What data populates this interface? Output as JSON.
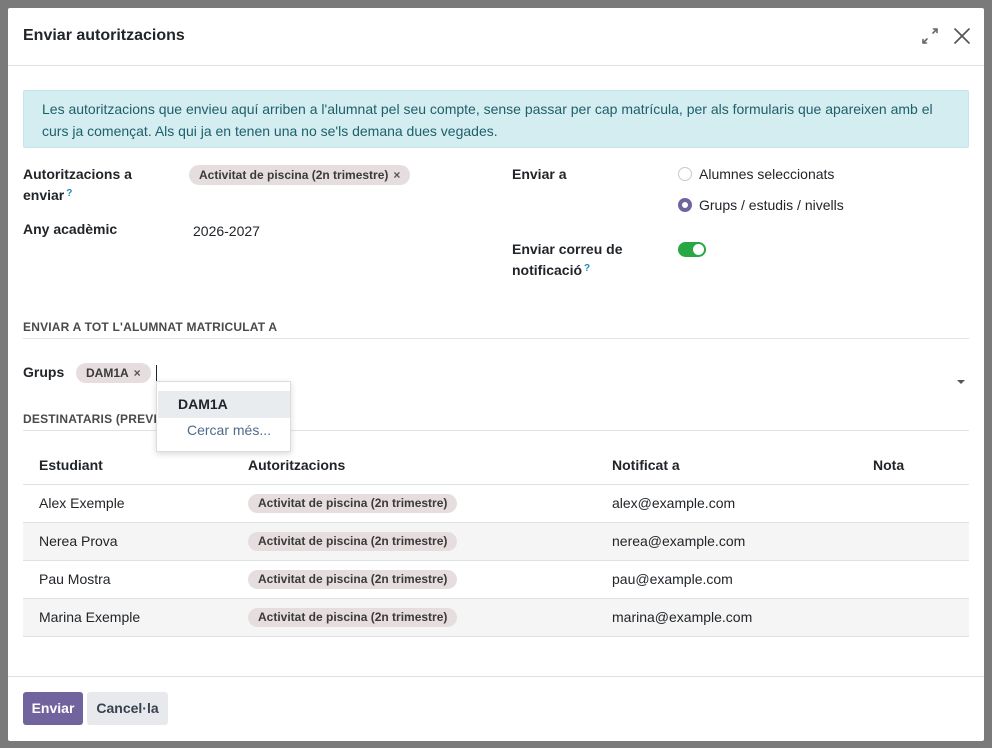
{
  "dialog": {
    "title": "Enviar autoritzacions",
    "expand_icon": "expand-icon",
    "close_icon": "close-icon"
  },
  "alert": {
    "text": "Les autoritzacions que envieu aquí arriben a l'alumnat pel seu compte, sense passar per cap matrícula, per als formularis que apareixen amb el curs ja començat. Als qui ja en tenen una no se'ls demana dues vegades."
  },
  "form": {
    "authorizations_label_1": "Autoritzacions a",
    "authorizations_label_2": "enviar",
    "help_mark": "?",
    "authorizations_tag": "Activitat de piscina (2n trimestre)",
    "tag_remove": "×",
    "year_label": "Any acadèmic",
    "year_value": "2026-2027",
    "send_to_label": "Enviar a",
    "send_to_options": [
      {
        "label": "Alumnes seleccionats",
        "selected": false
      },
      {
        "label": "Grups / estudis / nivells",
        "selected": true
      }
    ],
    "notify_label_1": "Enviar correu de",
    "notify_label_2": "notificació",
    "notify_enabled": true
  },
  "section_all": {
    "title": "ENVIAR A TOT L'ALUMNAT MATRICULAT A",
    "groups_label": "Grups",
    "group_tag": "DAM1A"
  },
  "dropdown": {
    "option_1": "DAM1A",
    "search_more": "Cercar més..."
  },
  "section_recipients": {
    "title": "DESTINATARIS (PREVI"
  },
  "table": {
    "headers": [
      "Estudiant",
      "Autoritzacions",
      "Notificat a",
      "Nota"
    ],
    "rows": [
      {
        "student": "Alex Exemple",
        "auth": "Activitat de piscina (2n trimestre)",
        "notified": "alex@example.com",
        "note": ""
      },
      {
        "student": "Nerea Prova",
        "auth": "Activitat de piscina (2n trimestre)",
        "notified": "nerea@example.com",
        "note": ""
      },
      {
        "student": "Pau Mostra",
        "auth": "Activitat de piscina (2n trimestre)",
        "notified": "pau@example.com",
        "note": ""
      },
      {
        "student": "Marina Exemple",
        "auth": "Activitat de piscina (2n trimestre)",
        "notified": "marina@example.com",
        "note": ""
      }
    ]
  },
  "footer": {
    "send_label": "Enviar",
    "cancel_label": "Cancel·la"
  },
  "colors": {
    "primary": "#71639e",
    "alert_bg": "#d3edf0",
    "toggle_on": "#28a745",
    "tag_bg": "#e6dede"
  }
}
